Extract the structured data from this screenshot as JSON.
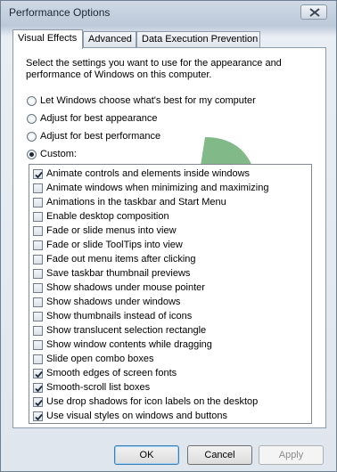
{
  "window": {
    "title": "Performance Options"
  },
  "tabs": [
    {
      "label": "Visual Effects",
      "active": true
    },
    {
      "label": "Advanced",
      "active": false
    },
    {
      "label": "Data Execution Prevention",
      "active": false
    }
  ],
  "visual_effects": {
    "description": "Select the settings you want to use for the appearance and performance of Windows on this computer.",
    "radios": [
      {
        "label": "Let Windows choose what's best for my computer",
        "selected": false
      },
      {
        "label": "Adjust for best appearance",
        "selected": false
      },
      {
        "label": "Adjust for best performance",
        "selected": false
      },
      {
        "label": "Custom:",
        "selected": true
      }
    ],
    "effects": [
      {
        "label": "Animate controls and elements inside windows",
        "checked": true
      },
      {
        "label": "Animate windows when minimizing and maximizing",
        "checked": false
      },
      {
        "label": "Animations in the taskbar and Start Menu",
        "checked": false
      },
      {
        "label": "Enable desktop composition",
        "checked": false
      },
      {
        "label": "Fade or slide menus into view",
        "checked": false
      },
      {
        "label": "Fade or slide ToolTips into view",
        "checked": false
      },
      {
        "label": "Fade out menu items after clicking",
        "checked": false
      },
      {
        "label": "Save taskbar thumbnail previews",
        "checked": false
      },
      {
        "label": "Show shadows under mouse pointer",
        "checked": false
      },
      {
        "label": "Show shadows under windows",
        "checked": false
      },
      {
        "label": "Show thumbnails instead of icons",
        "checked": false
      },
      {
        "label": "Show translucent selection rectangle",
        "checked": false
      },
      {
        "label": "Show window contents while dragging",
        "checked": false
      },
      {
        "label": "Slide open combo boxes",
        "checked": false
      },
      {
        "label": "Smooth edges of screen fonts",
        "checked": true
      },
      {
        "label": "Smooth-scroll list boxes",
        "checked": true
      },
      {
        "label": "Use drop shadows for icon labels on the desktop",
        "checked": true
      },
      {
        "label": "Use visual styles on windows and buttons",
        "checked": true
      }
    ]
  },
  "buttons": {
    "ok": {
      "label": "OK",
      "enabled": true
    },
    "cancel": {
      "label": "Cancel",
      "enabled": true
    },
    "apply": {
      "label": "Apply",
      "enabled": false
    }
  },
  "icons": {
    "close": "close-icon",
    "check": "checkmark-icon"
  },
  "colors": {
    "watermark": "#2e8b3a",
    "selected_dot": "#1d2836"
  }
}
